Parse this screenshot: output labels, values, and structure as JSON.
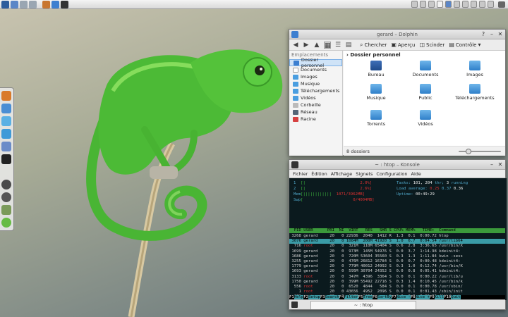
{
  "dolphin": {
    "title": "gerard – Dolphin",
    "toolbar": {
      "search": "Chercher",
      "preview": "Aperçu",
      "split": "Scinder",
      "control": "Contrôle"
    },
    "places_header": "Emplacements",
    "places": [
      {
        "label": "Dossier personnel",
        "color": "#3c7fd0"
      },
      {
        "label": "Documents",
        "color": "#ffffff"
      },
      {
        "label": "Images",
        "color": "#4a9ee0"
      },
      {
        "label": "Musique",
        "color": "#4a9ee0"
      },
      {
        "label": "Téléchargements",
        "color": "#4a9ee0"
      },
      {
        "label": "Vidéos",
        "color": "#4a9ee0"
      },
      {
        "label": "Corbeille",
        "color": "#bbbbbb"
      },
      {
        "label": "Réseau",
        "color": "#556677"
      },
      {
        "label": "Racine",
        "color": "#d64040"
      }
    ],
    "breadcrumb": "Dossier personnel",
    "folders": [
      "Bureau",
      "Documents",
      "Images",
      "Musique",
      "Public",
      "Téléchargements",
      "Torrents",
      "Vidéos"
    ],
    "status": "8 dossiers"
  },
  "konsole": {
    "title": "~ : htop – Konsole",
    "menu": [
      "Fichier",
      "Édition",
      "Affichage",
      "Signets",
      "Configuration",
      "Aide"
    ],
    "tab_label": "~ : htop",
    "meters": [
      {
        "label": "1",
        "bar": "[|",
        "value": "2.0%]"
      },
      {
        "label": "2",
        "bar": "[|",
        "value": "2.6%]"
      },
      {
        "label": "Mem",
        "bar": "[||||||||||||",
        "value": "1071/3962MB]"
      },
      {
        "label": "Swp",
        "bar": "[",
        "value": "0/4004MB]"
      }
    ],
    "tasks": {
      "label": "Tasks:",
      "count": "101,",
      "thr_count": "204",
      "thr_label": "thr;",
      "running": "3",
      "running_label": "running"
    },
    "load": {
      "label": "Load average:",
      "l1": "0.25",
      "l2": "0.37",
      "l3": "0.36"
    },
    "uptime": {
      "label": "Uptime:",
      "value": "00:49:29"
    },
    "columns": "  PID USER      PRI  NI  VIRT   RES   SHR S CPU% MEM%   TIME+  Command",
    "processes": [
      {
        "pid": "3268",
        "user": "gerard",
        "pri": "20",
        "ni": "0",
        "virt": "22936",
        "res": "2040",
        "shr": "1412",
        "s": "R",
        "cpu": "1.3",
        "mem": "0.1",
        "time": "0:00.72",
        "cmd": "htop"
      },
      {
        "pid": "3076",
        "user": "gerard",
        "pri": "20",
        "ni": "0",
        "virt": "1084M",
        "res": "200M",
        "shr": "41920",
        "s": "S",
        "cpu": "1.0",
        "mem": "6.7",
        "time": "0:04.54",
        "cmd": "/usr/lib64"
      },
      {
        "pid": "716",
        "user": "root",
        "pri": "20",
        "ni": "0",
        "virt": "321M",
        "res": "110M",
        "shr": "65404",
        "s": "S",
        "cpu": "0.6",
        "mem": "2.8",
        "time": "3:36.65",
        "cmd": "/usr/bin/X"
      },
      {
        "pid": "1699",
        "user": "gerard",
        "pri": "20",
        "ni": "0",
        "virt": "973M",
        "res": "145M",
        "shr": "54976",
        "s": "S",
        "cpu": "0.0",
        "mem": "3.7",
        "time": "1:14.98",
        "cmd": "kdeinit4:"
      },
      {
        "pid": "1686",
        "user": "gerard",
        "pri": "20",
        "ni": "0",
        "virt": "720M",
        "res": "53604",
        "shr": "35560",
        "s": "S",
        "cpu": "0.3",
        "mem": "1.3",
        "time": "1:11.84",
        "cmd": "kwin -sess"
      },
      {
        "pid": "3255",
        "user": "gerard",
        "pri": "20",
        "ni": "0",
        "virt": "476M",
        "res": "26812",
        "shr": "16784",
        "s": "S",
        "cpu": "0.0",
        "mem": "0.7",
        "time": "0:00.48",
        "cmd": "kdeinit4:"
      },
      {
        "pid": "1779",
        "user": "gerard",
        "pri": "20",
        "ni": "0",
        "virt": "779M",
        "res": "40012",
        "shr": "24992",
        "s": "S",
        "cpu": "0.3",
        "mem": "1.0",
        "time": "0:12.74",
        "cmd": "/usr/bin/K"
      },
      {
        "pid": "1693",
        "user": "gerard",
        "pri": "20",
        "ni": "0",
        "virt": "595M",
        "res": "30704",
        "shr": "24352",
        "s": "S",
        "cpu": "0.0",
        "mem": "0.8",
        "time": "0:05.41",
        "cmd": "kdeinit4:"
      },
      {
        "pid": "3133",
        "user": "root",
        "pri": "20",
        "ni": "0",
        "virt": "347M",
        "res": "4396",
        "shr": "3364",
        "s": "S",
        "cpu": "0.0",
        "mem": "0.1",
        "time": "0:00.22",
        "cmd": "/usr/lib/u"
      },
      {
        "pid": "1750",
        "user": "gerard",
        "pri": "20",
        "ni": "0",
        "virt": "399M",
        "res": "55492",
        "shr": "22716",
        "s": "S",
        "cpu": "0.3",
        "mem": "1.4",
        "time": "0:10.45",
        "cmd": "/usr/bin/k"
      },
      {
        "pid": "556",
        "user": "root",
        "pri": "20",
        "ni": "0",
        "virt": "6520",
        "res": "4844",
        "shr": "584",
        "s": "S",
        "cpu": "0.0",
        "mem": "0.1",
        "time": "0:00.78",
        "cmd": "/usr/sbin/"
      },
      {
        "pid": "1",
        "user": "root",
        "pri": "20",
        "ni": "0",
        "virt": "43656",
        "res": "4952",
        "shr": "2096",
        "s": "S",
        "cpu": "0.0",
        "mem": "0.1",
        "time": "0:01.43",
        "cmd": "/sbin/init"
      },
      {
        "pid": "271",
        "user": "root",
        "pri": "20",
        "ni": "0",
        "virt": "1972",
        "res": "1664",
        "shr": "",
        "s": "S",
        "cpu": "0.0",
        "mem": "0.0",
        "time": "0:00.22",
        "cmd": "/lib/syste"
      }
    ],
    "fkeys": [
      "F1Help",
      "F2Setup",
      "F3Search",
      "F4Filter",
      "F5Tree",
      "F6SortBy",
      "F7Nice -",
      "F8Nice +",
      "F9Kill",
      "F10Quit"
    ]
  },
  "colors": {
    "selection": "#3a9ba6",
    "header_green": "#3b9a3b",
    "red_value": "#d83030",
    "cyan_label": "#4fa6c8"
  }
}
